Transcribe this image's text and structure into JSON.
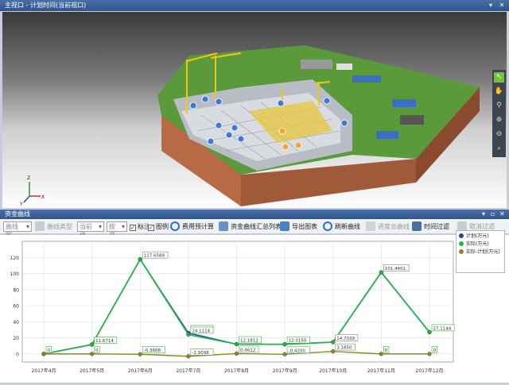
{
  "window": {
    "title": "主视口 - 计划时间(当前视口)",
    "controls": [
      "▾",
      "✕"
    ]
  },
  "scene_toolbar": {
    "tools": [
      {
        "icon": "select-arrow-icon",
        "glyph": "↖",
        "active": true
      },
      {
        "icon": "hand-pan-icon",
        "glyph": "✋",
        "active": false
      },
      {
        "icon": "walk-icon",
        "glyph": "⚲",
        "active": false
      },
      {
        "icon": "zoom-in-icon",
        "glyph": "⊕",
        "active": false
      },
      {
        "icon": "zoom-out-icon",
        "glyph": "⊖",
        "active": false
      },
      {
        "icon": "zoom-fit-icon",
        "glyph": "⌕",
        "active": false
      }
    ]
  },
  "axis_gizmo": {
    "x": "X",
    "y": "Y",
    "z": "Z"
  },
  "panel": {
    "title": "资金曲线",
    "controls": [
      "▾",
      "▫",
      "✕"
    ]
  },
  "toolbar": {
    "view_select": "曲线图",
    "curve_type": "曲线类型",
    "value_select": "当前值",
    "period_select": "按月",
    "annotate_label": "标注",
    "legend_label": "图例",
    "annotate_checked": true,
    "legend_checked": true,
    "cost_budget": "费用预计算",
    "summary_list": "资金曲线汇总列表",
    "export_chart": "导出图表",
    "refresh_curve": "刷新曲线",
    "schedule_curve": "进度总曲线",
    "time_filter": "时间过滤",
    "clear_filter": "取消过滤"
  },
  "colors": {
    "plan": "#2b3fa8",
    "actual": "#23b34a",
    "diff": "#8a8a1e",
    "label_border": "#4aa84a"
  },
  "chart_data": {
    "type": "line",
    "categories": [
      "2017年4月",
      "2017年5月",
      "2017年6月",
      "2017年7月",
      "2017年8月",
      "2017年9月",
      "2017年10月",
      "2017年11月",
      "2017年12月"
    ],
    "ylim": [
      -10,
      140
    ],
    "yticks": [
      0,
      20,
      40,
      60,
      80,
      100,
      120
    ],
    "grid": true,
    "legend_position": "top-right",
    "series": [
      {
        "name": "计划(万元)",
        "values": [
          0,
          11.6714,
          117.6589,
          26.1114,
          12.1812,
          12.015,
          14.7039,
          101.4601,
          27.1144
        ]
      },
      {
        "name": "实际(万元)",
        "values": [
          0,
          11.6714,
          117.6589,
          24.1114,
          12.1812,
          12.015,
          14.7039,
          101.4601,
          27.1144
        ]
      },
      {
        "name": "实际-计划(万元)",
        "values": [
          0,
          0,
          -0.3668,
          -2.9598,
          0.4612,
          -0.42,
          3.185,
          0,
          0
        ]
      }
    ],
    "data_labels": [
      {
        "text": "0",
        "idx": 0,
        "v": 0
      },
      {
        "text": "11.6714",
        "idx": 1,
        "v": 11.6714
      },
      {
        "text": "117.6589",
        "idx": 2,
        "v": 117.6589
      },
      {
        "text": "26.1114",
        "idx": 3,
        "v": 26.1114
      },
      {
        "text": "24.1114",
        "idx": 3,
        "v": 24.1114
      },
      {
        "text": "12.1812",
        "idx": 4,
        "v": 12.1812
      },
      {
        "text": "12.0150",
        "idx": 5,
        "v": 12.015
      },
      {
        "text": "14.7039",
        "idx": 6,
        "v": 14.7039
      },
      {
        "text": "101.4601",
        "idx": 7,
        "v": 101.4601
      },
      {
        "text": "27.1144",
        "idx": 8,
        "v": 27.1144
      },
      {
        "text": "0",
        "idx": 1,
        "v": 0
      },
      {
        "text": "-0.3668",
        "idx": 2,
        "v": -0.3668
      },
      {
        "text": "-2.9598",
        "idx": 3,
        "v": -2.9598
      },
      {
        "text": "0.4612",
        "idx": 4,
        "v": 0.4612
      },
      {
        "text": "-0.4200",
        "idx": 5,
        "v": -0.42
      },
      {
        "text": "3.1850",
        "idx": 6,
        "v": 3.185
      },
      {
        "text": "0",
        "idx": 7,
        "v": 0
      },
      {
        "text": "0",
        "idx": 8,
        "v": 0
      }
    ]
  }
}
